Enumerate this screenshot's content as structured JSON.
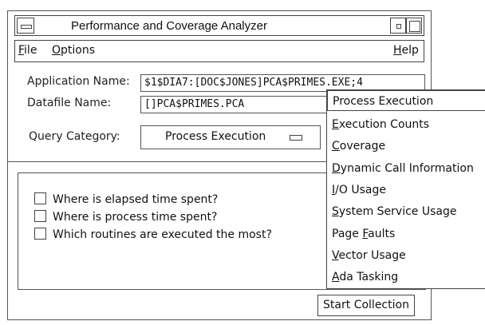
{
  "window": {
    "title": "Performance and Coverage Analyzer"
  },
  "menubar": {
    "file": {
      "underlined": "F",
      "rest": "ile"
    },
    "options": {
      "underlined": "O",
      "rest": "ptions"
    },
    "help": {
      "underlined": "H",
      "rest": "elp"
    }
  },
  "form": {
    "app_label": "Application Name:",
    "app_value": "$1$DIA7:[DOC$JONES]PCA$PRIMES.EXE;4",
    "datafile_label": "Datafile Name:",
    "datafile_value": "[]PCA$PRIMES.PCA",
    "query_label": "Query Category:",
    "query_value": "Process Execution"
  },
  "queries": [
    {
      "label": "Where is elapsed time spent?",
      "checked": false
    },
    {
      "label": "Where is process time spent?",
      "checked": false
    },
    {
      "label": "Which routines are executed the most?",
      "checked": false
    }
  ],
  "start_button": "Start Collection",
  "popup": {
    "items": [
      {
        "pre": "",
        "u": "",
        "post": "Process Execution",
        "selected": true
      },
      {
        "pre": "",
        "u": "E",
        "post": "xecution Counts"
      },
      {
        "pre": "",
        "u": "C",
        "post": "overage"
      },
      {
        "pre": "",
        "u": "D",
        "post": "ynamic Call Information"
      },
      {
        "pre": "",
        "u": "I",
        "post": "/O Usage"
      },
      {
        "pre": "",
        "u": "S",
        "post": "ystem Service Usage"
      },
      {
        "pre": "Page ",
        "u": "F",
        "post": "aults"
      },
      {
        "pre": "",
        "u": "V",
        "post": "ector Usage"
      },
      {
        "pre": "",
        "u": "A",
        "post": "da Tasking"
      }
    ]
  }
}
